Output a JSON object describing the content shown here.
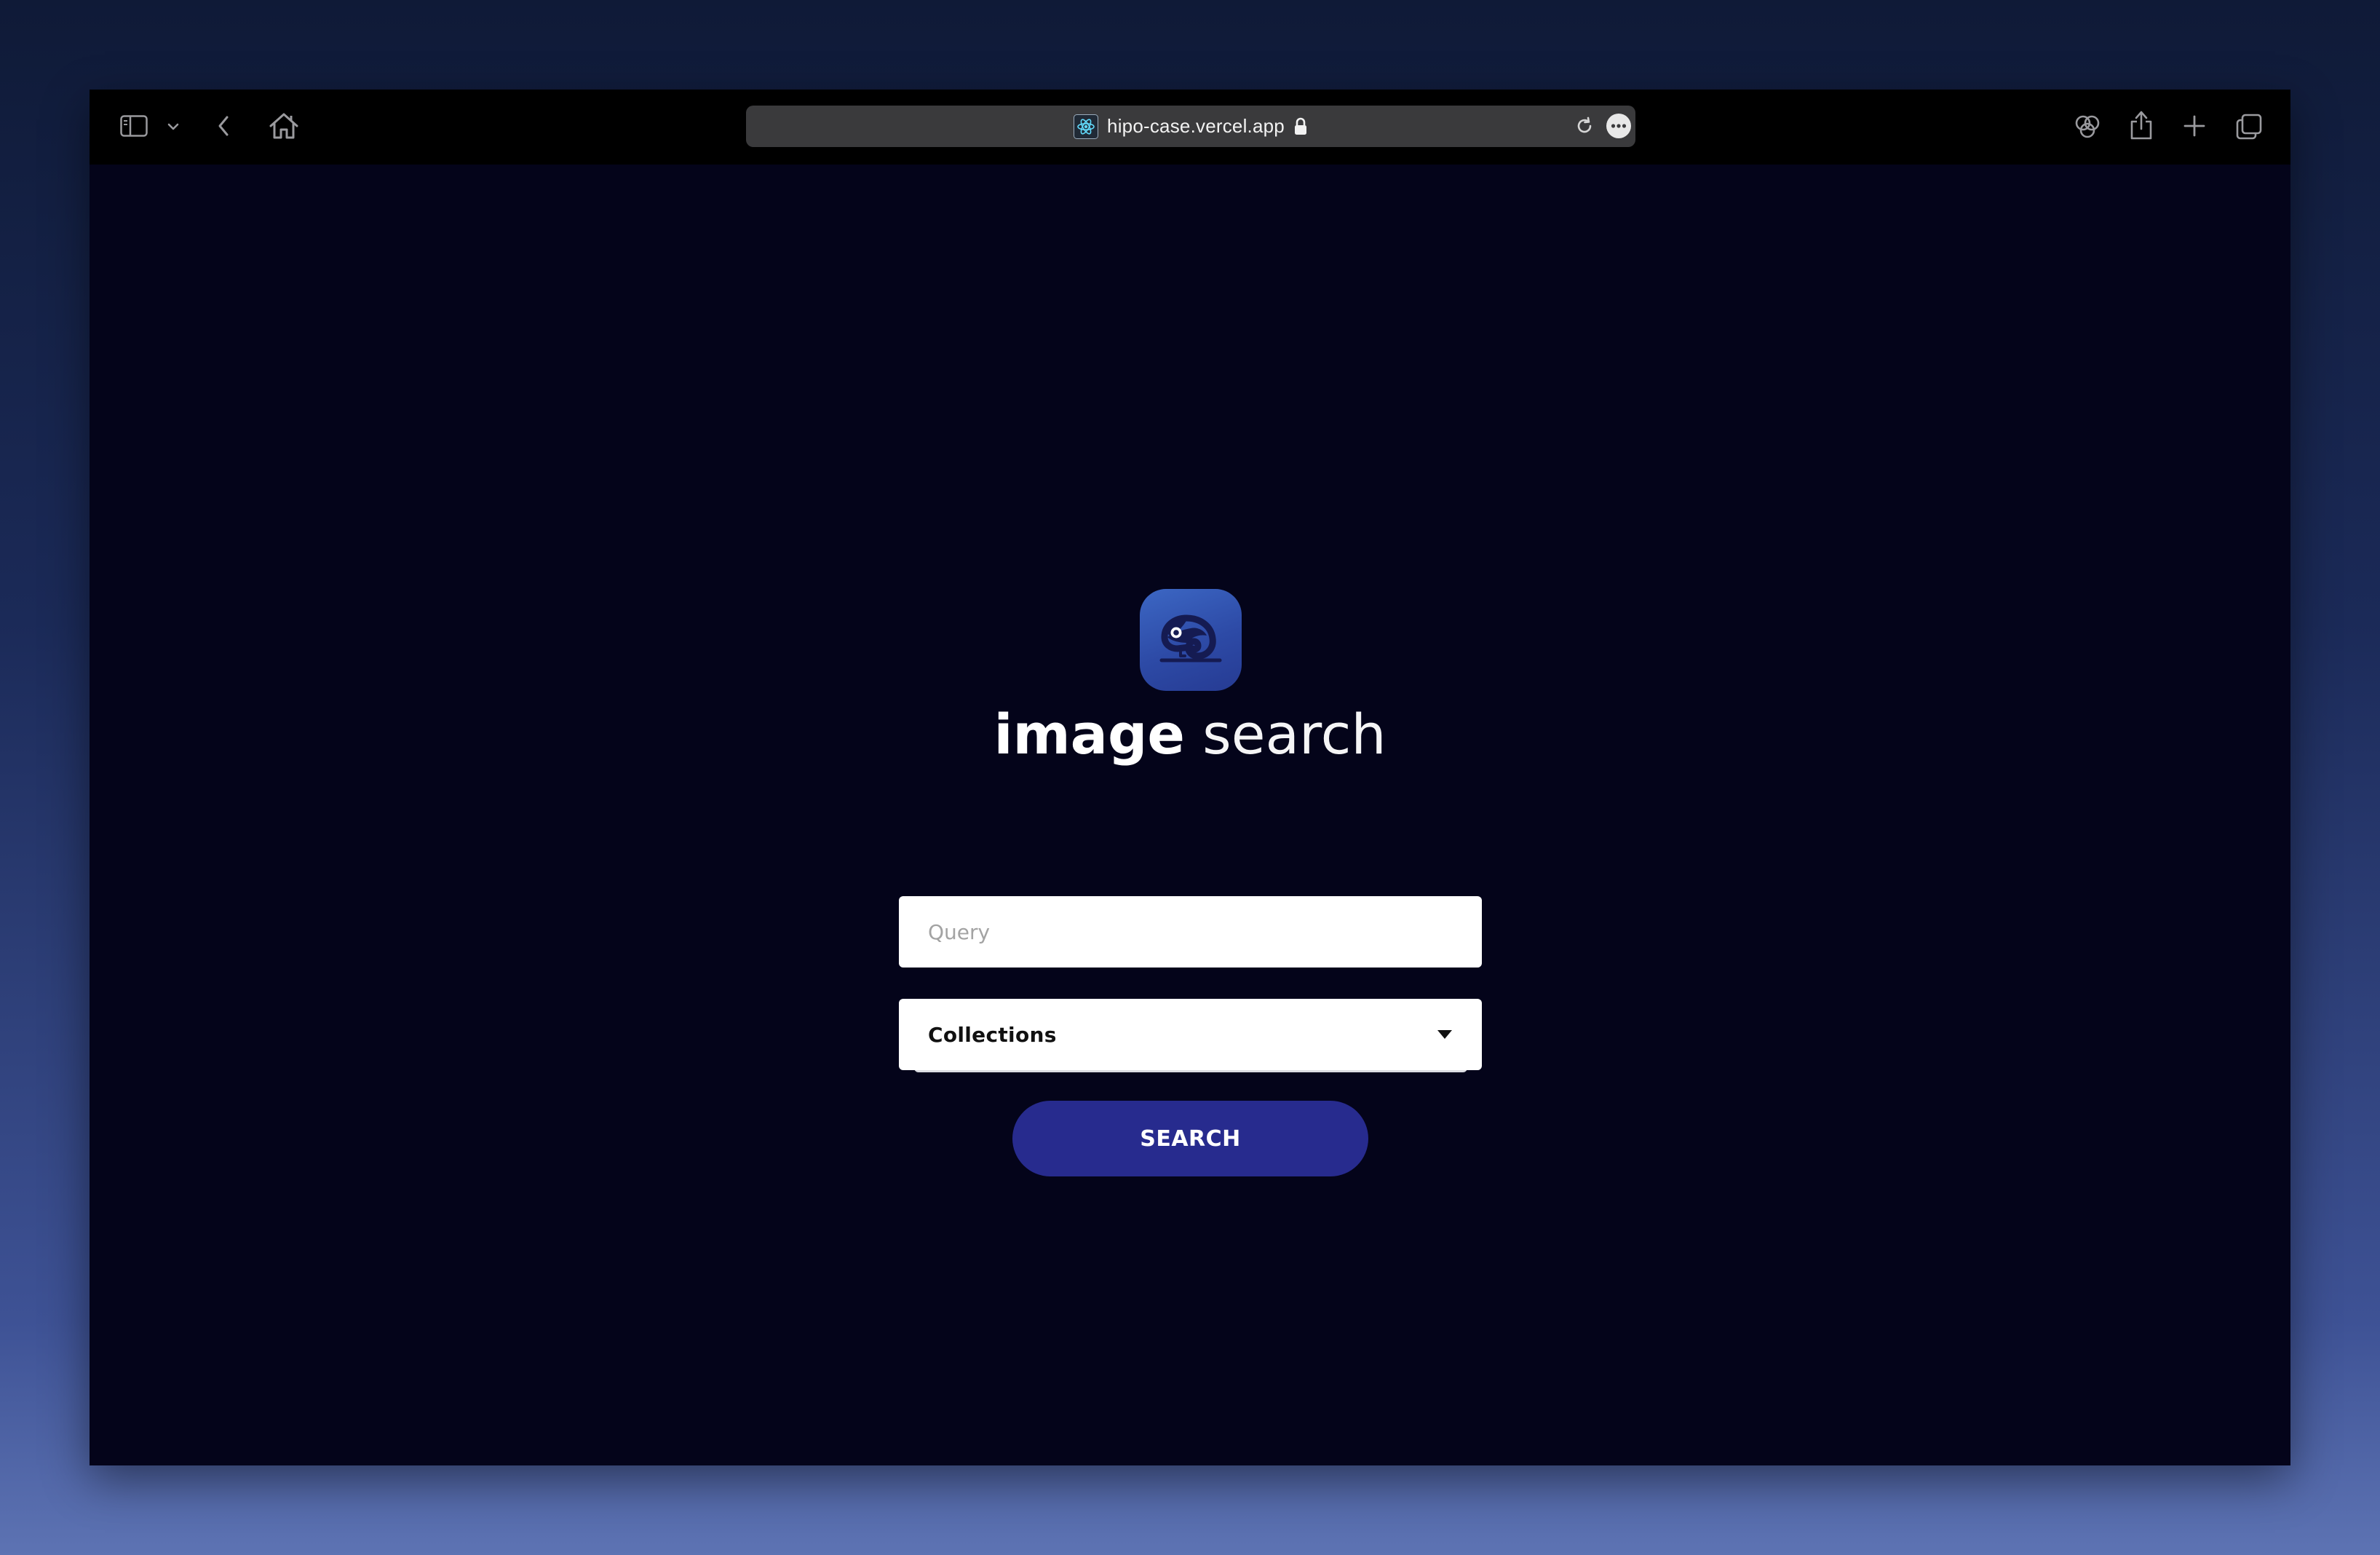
{
  "browser": {
    "url": "hipo-case.vercel.app",
    "icons": {
      "sidebar": "sidebar-icon",
      "sidebar_menu": "chevron-down-icon",
      "back": "back-icon",
      "home": "home-icon",
      "site": "react-favicon-icon",
      "secure": "lock-icon",
      "reload": "reload-icon",
      "more": "more-icon",
      "extensions": "extensions-icon",
      "share": "share-icon",
      "new_tab": "plus-icon",
      "tabs": "tabs-overview-icon"
    }
  },
  "app": {
    "logo_icon": "chameleon-icon",
    "title_bold": "image",
    "title_light": "search",
    "query": {
      "value": "",
      "placeholder": "Query"
    },
    "collections": {
      "selected": "Collections",
      "icon": "caret-down-icon"
    },
    "search_label": "SEARCH"
  },
  "colors": {
    "page_background": "#04041a",
    "toolbar": "#000000",
    "url_bar": "#3a3a3c",
    "logo_gradient_top": "#3c67c4",
    "logo_gradient_bottom": "#263b93",
    "button": "#272b8e"
  }
}
